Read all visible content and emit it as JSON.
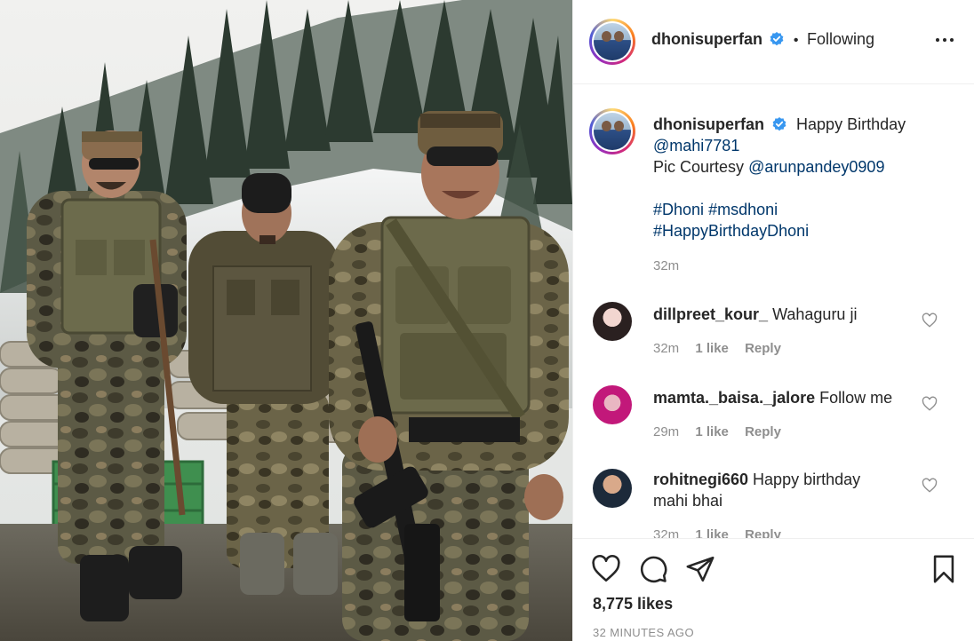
{
  "post": {
    "image_alt": "Soldiers in camouflage uniforms standing on a snowy mountain slope with pine trees and sandbag bunkers",
    "header": {
      "username": "dhonisuperfan",
      "separator": "•",
      "follow_status": "Following",
      "more_icon": "more-horizontal-icon"
    },
    "caption": {
      "username": "dhonisuperfan",
      "line1": "Happy Birthday",
      "mention1": "@mahi7781",
      "courtesy_prefix": "Pic Courtesy",
      "mention2": "@arunpandey0909",
      "hashtags_line1a": "#Dhoni",
      "hashtags_line1b": "#msdhoni",
      "hashtags_line2": "#HappyBirthdayDhoni",
      "time": "32m"
    },
    "comments": [
      {
        "username": "dillpreet_kour_",
        "text": "Wahaguru ji",
        "time": "32m",
        "likes": "1 like",
        "reply": "Reply"
      },
      {
        "username": "mamta._baisa._jalore",
        "text": "Follow me",
        "time": "29m",
        "likes": "1 like",
        "reply": "Reply"
      },
      {
        "username": "rohitnegi660",
        "text": "Happy birthday",
        "text2": "mahi bhai",
        "time": "32m",
        "likes": "1 like",
        "reply": "Reply"
      }
    ],
    "actions": {
      "like_icon": "heart-icon",
      "comment_icon": "comment-icon",
      "share_icon": "paper-plane-icon",
      "save_icon": "bookmark-icon"
    },
    "likes_count": "8,775 likes",
    "timestamp": "32 MINUTES AGO"
  },
  "colors": {
    "link": "#00376b",
    "text": "#262626",
    "muted": "#8e8e8e",
    "verified": "#3897f0",
    "border": "#efefef"
  }
}
